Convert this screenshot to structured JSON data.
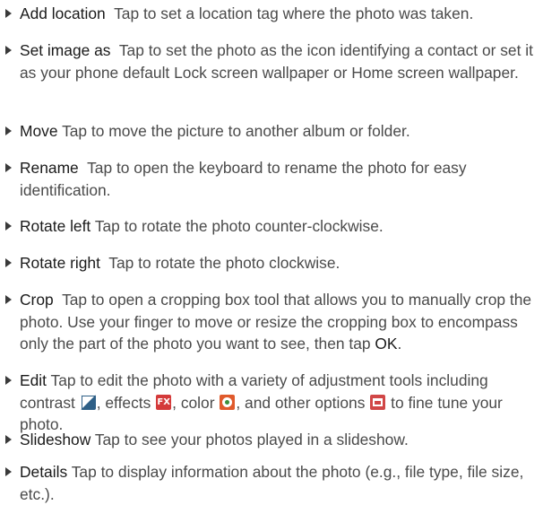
{
  "items": [
    {
      "term": "Add location",
      "desc": "Tap to set a location tag where the photo was taken."
    },
    {
      "term": "Set image as",
      "desc": "Tap to set the photo as the icon identifying a contact or set it as your phone default Lock screen wallpaper or Home screen wallpaper."
    },
    {
      "term": "Move",
      "desc": "Tap to move the picture to another album or folder."
    },
    {
      "term": "Rename",
      "desc": "Tap to open the keyboard to rename the photo for easy identification."
    },
    {
      "term": "Rotate left",
      "desc": "Tap to rotate the photo counter-clockwise."
    },
    {
      "term": "Rotate right",
      "desc": "Tap to rotate the photo clockwise."
    },
    {
      "term": "Crop",
      "desc": "Tap to open a cropping box tool that allows you to manually crop the photo. Use your finger to move or resize the cropping box to encompass only the part of the photo you want to see, then tap",
      "ok": "OK",
      "end": "."
    },
    {
      "term": "Edit",
      "desc_a": "Tap to edit the photo with a variety of adjustment tools including contrast",
      "desc_b": ", effects",
      "desc_c": ", color",
      "desc_d": ", and other options",
      "desc_e": "to fine tune your photo.",
      "icons": [
        "contrast-icon",
        "fx-icon",
        "color-icon",
        "other-options-icon"
      ],
      "fx_label": "FX"
    },
    {
      "term": "Slideshow",
      "desc": "Tap to see your photos played in a slideshow."
    },
    {
      "term": "Details",
      "desc": "Tap to display information about the photo (e.g., file type, file size, etc.)."
    }
  ]
}
